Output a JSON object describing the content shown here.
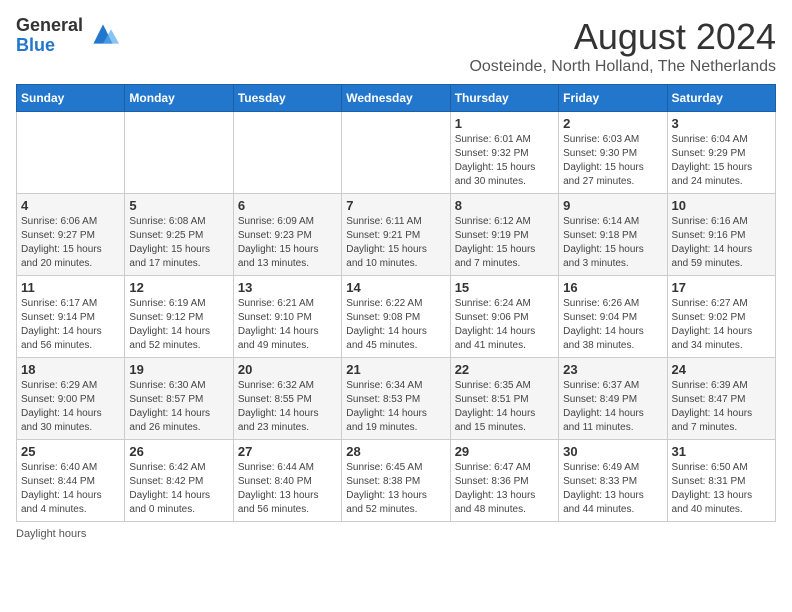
{
  "logo": {
    "general": "General",
    "blue": "Blue"
  },
  "title": {
    "month_year": "August 2024",
    "location": "Oosteinde, North Holland, The Netherlands"
  },
  "weekdays": [
    "Sunday",
    "Monday",
    "Tuesday",
    "Wednesday",
    "Thursday",
    "Friday",
    "Saturday"
  ],
  "weeks": [
    [
      {
        "day": "",
        "sunrise": "",
        "sunset": "",
        "daylight": ""
      },
      {
        "day": "",
        "sunrise": "",
        "sunset": "",
        "daylight": ""
      },
      {
        "day": "",
        "sunrise": "",
        "sunset": "",
        "daylight": ""
      },
      {
        "day": "",
        "sunrise": "",
        "sunset": "",
        "daylight": ""
      },
      {
        "day": "1",
        "sunrise": "Sunrise: 6:01 AM",
        "sunset": "Sunset: 9:32 PM",
        "daylight": "Daylight: 15 hours and 30 minutes."
      },
      {
        "day": "2",
        "sunrise": "Sunrise: 6:03 AM",
        "sunset": "Sunset: 9:30 PM",
        "daylight": "Daylight: 15 hours and 27 minutes."
      },
      {
        "day": "3",
        "sunrise": "Sunrise: 6:04 AM",
        "sunset": "Sunset: 9:29 PM",
        "daylight": "Daylight: 15 hours and 24 minutes."
      }
    ],
    [
      {
        "day": "4",
        "sunrise": "Sunrise: 6:06 AM",
        "sunset": "Sunset: 9:27 PM",
        "daylight": "Daylight: 15 hours and 20 minutes."
      },
      {
        "day": "5",
        "sunrise": "Sunrise: 6:08 AM",
        "sunset": "Sunset: 9:25 PM",
        "daylight": "Daylight: 15 hours and 17 minutes."
      },
      {
        "day": "6",
        "sunrise": "Sunrise: 6:09 AM",
        "sunset": "Sunset: 9:23 PM",
        "daylight": "Daylight: 15 hours and 13 minutes."
      },
      {
        "day": "7",
        "sunrise": "Sunrise: 6:11 AM",
        "sunset": "Sunset: 9:21 PM",
        "daylight": "Daylight: 15 hours and 10 minutes."
      },
      {
        "day": "8",
        "sunrise": "Sunrise: 6:12 AM",
        "sunset": "Sunset: 9:19 PM",
        "daylight": "Daylight: 15 hours and 7 minutes."
      },
      {
        "day": "9",
        "sunrise": "Sunrise: 6:14 AM",
        "sunset": "Sunset: 9:18 PM",
        "daylight": "Daylight: 15 hours and 3 minutes."
      },
      {
        "day": "10",
        "sunrise": "Sunrise: 6:16 AM",
        "sunset": "Sunset: 9:16 PM",
        "daylight": "Daylight: 14 hours and 59 minutes."
      }
    ],
    [
      {
        "day": "11",
        "sunrise": "Sunrise: 6:17 AM",
        "sunset": "Sunset: 9:14 PM",
        "daylight": "Daylight: 14 hours and 56 minutes."
      },
      {
        "day": "12",
        "sunrise": "Sunrise: 6:19 AM",
        "sunset": "Sunset: 9:12 PM",
        "daylight": "Daylight: 14 hours and 52 minutes."
      },
      {
        "day": "13",
        "sunrise": "Sunrise: 6:21 AM",
        "sunset": "Sunset: 9:10 PM",
        "daylight": "Daylight: 14 hours and 49 minutes."
      },
      {
        "day": "14",
        "sunrise": "Sunrise: 6:22 AM",
        "sunset": "Sunset: 9:08 PM",
        "daylight": "Daylight: 14 hours and 45 minutes."
      },
      {
        "day": "15",
        "sunrise": "Sunrise: 6:24 AM",
        "sunset": "Sunset: 9:06 PM",
        "daylight": "Daylight: 14 hours and 41 minutes."
      },
      {
        "day": "16",
        "sunrise": "Sunrise: 6:26 AM",
        "sunset": "Sunset: 9:04 PM",
        "daylight": "Daylight: 14 hours and 38 minutes."
      },
      {
        "day": "17",
        "sunrise": "Sunrise: 6:27 AM",
        "sunset": "Sunset: 9:02 PM",
        "daylight": "Daylight: 14 hours and 34 minutes."
      }
    ],
    [
      {
        "day": "18",
        "sunrise": "Sunrise: 6:29 AM",
        "sunset": "Sunset: 9:00 PM",
        "daylight": "Daylight: 14 hours and 30 minutes."
      },
      {
        "day": "19",
        "sunrise": "Sunrise: 6:30 AM",
        "sunset": "Sunset: 8:57 PM",
        "daylight": "Daylight: 14 hours and 26 minutes."
      },
      {
        "day": "20",
        "sunrise": "Sunrise: 6:32 AM",
        "sunset": "Sunset: 8:55 PM",
        "daylight": "Daylight: 14 hours and 23 minutes."
      },
      {
        "day": "21",
        "sunrise": "Sunrise: 6:34 AM",
        "sunset": "Sunset: 8:53 PM",
        "daylight": "Daylight: 14 hours and 19 minutes."
      },
      {
        "day": "22",
        "sunrise": "Sunrise: 6:35 AM",
        "sunset": "Sunset: 8:51 PM",
        "daylight": "Daylight: 14 hours and 15 minutes."
      },
      {
        "day": "23",
        "sunrise": "Sunrise: 6:37 AM",
        "sunset": "Sunset: 8:49 PM",
        "daylight": "Daylight: 14 hours and 11 minutes."
      },
      {
        "day": "24",
        "sunrise": "Sunrise: 6:39 AM",
        "sunset": "Sunset: 8:47 PM",
        "daylight": "Daylight: 14 hours and 7 minutes."
      }
    ],
    [
      {
        "day": "25",
        "sunrise": "Sunrise: 6:40 AM",
        "sunset": "Sunset: 8:44 PM",
        "daylight": "Daylight: 14 hours and 4 minutes."
      },
      {
        "day": "26",
        "sunrise": "Sunrise: 6:42 AM",
        "sunset": "Sunset: 8:42 PM",
        "daylight": "Daylight: 14 hours and 0 minutes."
      },
      {
        "day": "27",
        "sunrise": "Sunrise: 6:44 AM",
        "sunset": "Sunset: 8:40 PM",
        "daylight": "Daylight: 13 hours and 56 minutes."
      },
      {
        "day": "28",
        "sunrise": "Sunrise: 6:45 AM",
        "sunset": "Sunset: 8:38 PM",
        "daylight": "Daylight: 13 hours and 52 minutes."
      },
      {
        "day": "29",
        "sunrise": "Sunrise: 6:47 AM",
        "sunset": "Sunset: 8:36 PM",
        "daylight": "Daylight: 13 hours and 48 minutes."
      },
      {
        "day": "30",
        "sunrise": "Sunrise: 6:49 AM",
        "sunset": "Sunset: 8:33 PM",
        "daylight": "Daylight: 13 hours and 44 minutes."
      },
      {
        "day": "31",
        "sunrise": "Sunrise: 6:50 AM",
        "sunset": "Sunset: 8:31 PM",
        "daylight": "Daylight: 13 hours and 40 minutes."
      }
    ]
  ],
  "footer": {
    "note": "Daylight hours"
  }
}
